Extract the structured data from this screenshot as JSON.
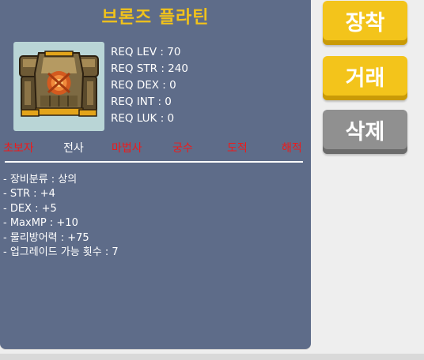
{
  "item": {
    "name": "브론즈 플라틴",
    "image_icon": "bronze-platine-armor-icon",
    "requirements": [
      "REQ LEV : 70",
      "REQ STR : 240",
      "REQ DEX : 0",
      "REQ INT : 0",
      "REQ LUK : 0"
    ],
    "jobs": [
      {
        "label": "초보자",
        "status": "required"
      },
      {
        "label": "전사",
        "status": "available"
      },
      {
        "label": "마법사",
        "status": "required"
      },
      {
        "label": "궁수",
        "status": "required"
      },
      {
        "label": "도적",
        "status": "required"
      },
      {
        "label": "해적",
        "status": "required"
      }
    ],
    "details": [
      "- 장비분류 : 상의",
      "- STR : +4",
      "- DEX : +5",
      "- MaxMP : +10",
      "- 물리방어력 : +75",
      "- 업그레이드 가능 횟수 : 7"
    ]
  },
  "actions": {
    "equip_label": "장착",
    "trade_label": "거래",
    "delete_label": "삭제"
  },
  "colors": {
    "panel_bg": "#5e6c89",
    "title": "#f1c21b",
    "job_required": "#ee1a1a",
    "job_available": "#ffffff",
    "button_primary": "#f3c41b",
    "button_disabled": "#909090",
    "image_bg": "#b9d5d6"
  }
}
